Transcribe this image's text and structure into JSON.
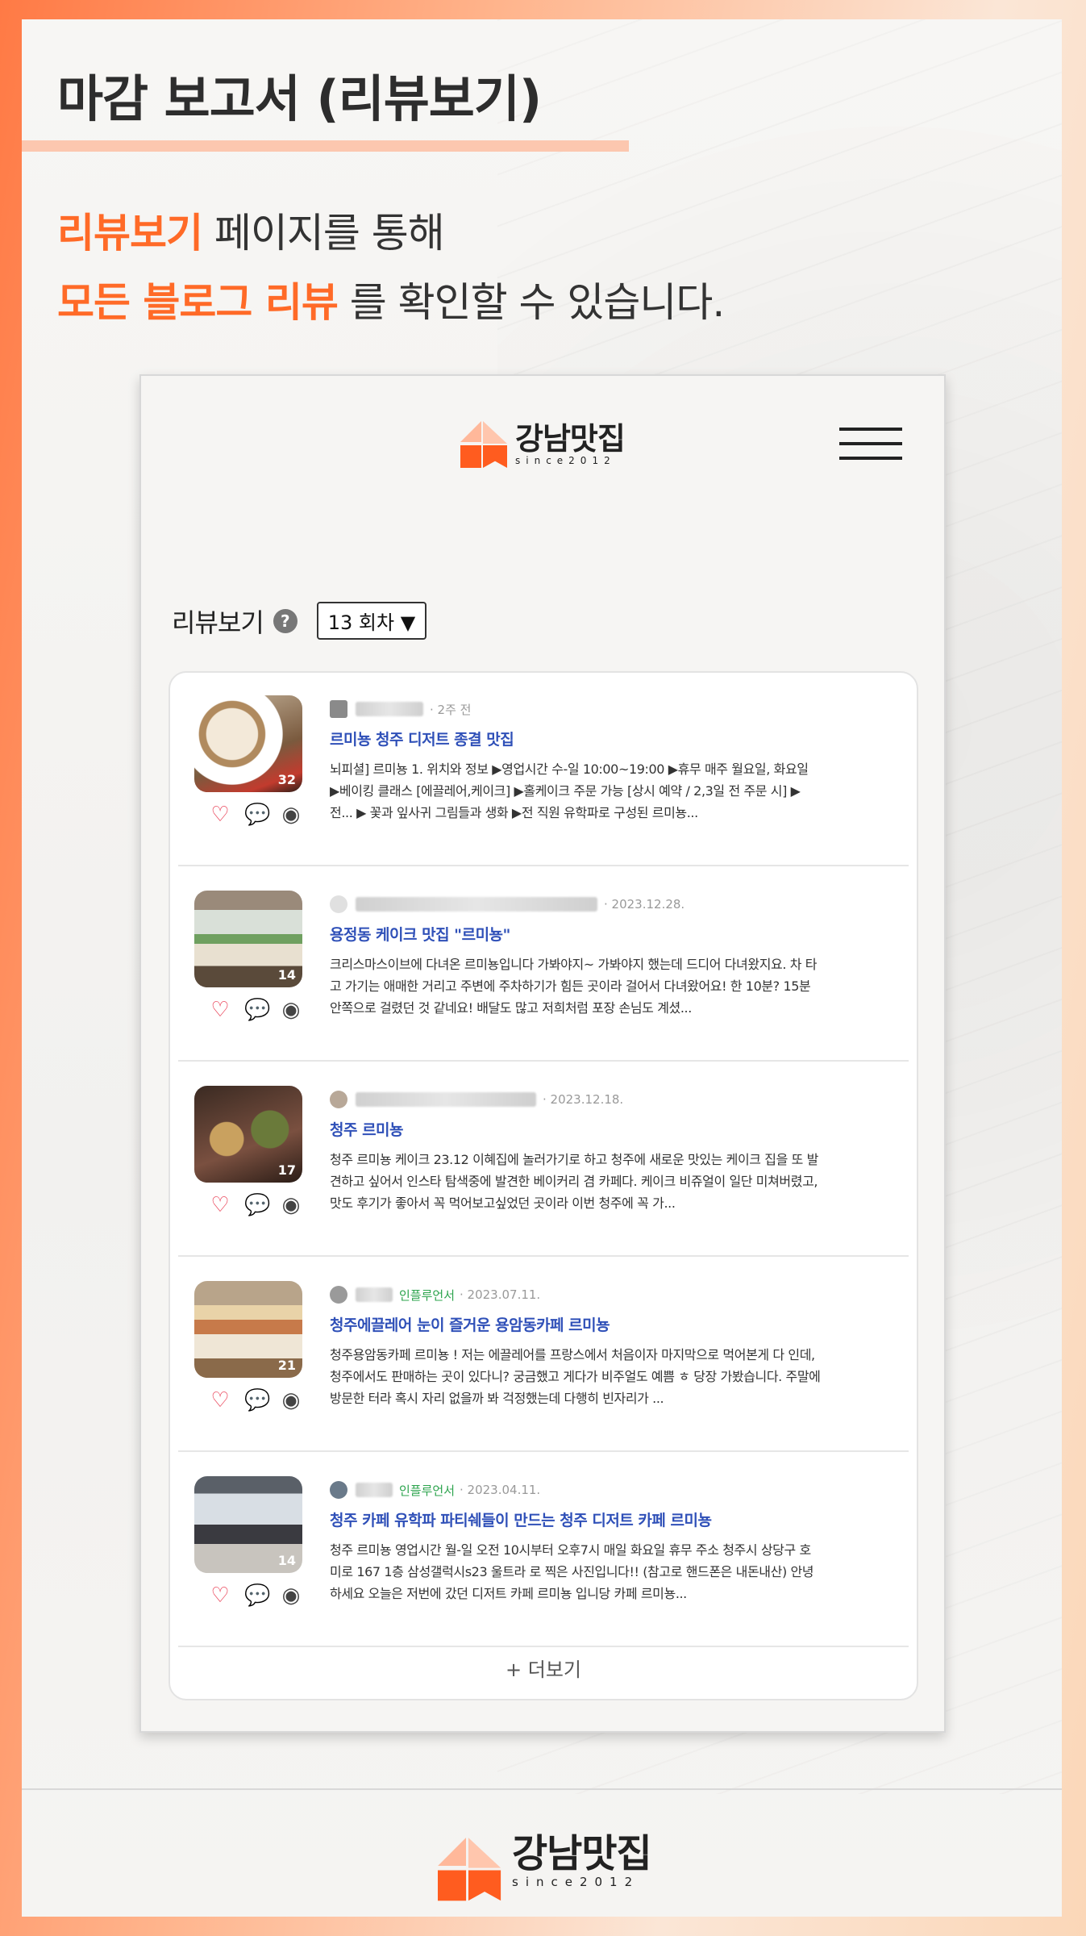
{
  "header": {
    "title": "마감 보고서 (리뷰보기)"
  },
  "intro": {
    "line1_hl": "리뷰보기",
    "line1_rest": " 페이지를 통해",
    "line2_hl": "모든 블로그 리뷰",
    "line2_rest": " 를 확인할 수 있습니다."
  },
  "app": {
    "logo_name": "강남맛집",
    "logo_since": "since2012"
  },
  "review": {
    "title": "리뷰보기",
    "help": "?",
    "round_select": "13 회차 ▼"
  },
  "items": [
    {
      "count": "32",
      "date": "· 2주 전",
      "influencer": "",
      "title": "르미뇽 청주 디저트 종결 맛집",
      "desc": "뇌피셜] 르미뇽 1. 위치와 정보 ▶영업시간 수-일 10:00~19:00 ▶휴무 매주 월요일, 화요일 ▶베이킹 클래스 [에끌레어,케이크] ▶홀케이크 주문 가능 [상시 예약 / 2,3일 전 주문 시] ▶전... ▶ 꽃과 잎사귀 그림들과 생화 ▶전 직원 유학파로 구성된 르미뇽..."
    },
    {
      "count": "14",
      "date": "· 2023.12.28.",
      "influencer": "",
      "title": "용정동 케이크 맛집 \"르미뇽\"",
      "desc": "크리스마스이브에 다녀온 르미뇽입니다 가봐야지~ 가봐야지 했는데 드디어 다녀왔지요. 차 타고 가기는 애매한 거리고 주변에 주차하기가 힘든 곳이라 걸어서 다녀왔어요! 한 10분? 15분 안쪽으로 걸렸던 것 같네요! 배달도 많고 저희처럼 포장 손님도 계셨..."
    },
    {
      "count": "17",
      "date": "· 2023.12.18.",
      "influencer": "",
      "title": "청주 르미뇽",
      "desc": "청주 르미뇽 케이크 23.12 이혜집에 놀러가기로 하고 청주에 새로운 맛있는 케이크 집을 또 발견하고 싶어서 인스타 탐색중에 발견한 베이커리 겸 카페다. 케이크 비쥬얼이 일단 미쳐버렸고, 맛도 후기가 좋아서 꼭 먹어보고싶었던 곳이라 이번 청주에 꼭 가..."
    },
    {
      "count": "21",
      "date": "· 2023.07.11.",
      "influencer": "인플루언서",
      "title": "청주에끌레어 눈이 즐거운 용암동카페 르미뇽",
      "desc": "청주용암동카페 르미뇽 ! 저는 에끌레어를 프랑스에서 처음이자 마지막으로 먹어본게 다 인데, 청주에서도 판매하는 곳이 있다니? 궁금했고 게다가 비주얼도 예쁨 ㅎ 당장 가봤습니다. 주말에 방문한 터라 혹시 자리 없을까 봐 걱정했는데 다행히 빈자리가 ..."
    },
    {
      "count": "14",
      "date": "· 2023.04.11.",
      "influencer": "인플루언서",
      "title": "청주 카페 유학파 파티쉐들이 만드는 청주 디저트 카페 르미뇽",
      "desc": "청주 르미뇽 영업시간 월-일 오전 10시부터 오후7시 매일 화요일 휴무 주소 청주시 상당구 호미로 167 1층 삼성갤럭시s23 울트라 로 찍은 사진입니다!! (참고로 핸드폰은 내돈내산) 안녕하세요 오늘은 저번에 갔던 디저트 카페 르미뇽 입니당 카페 르미뇽..."
    }
  ],
  "more_label": "+ 더보기",
  "colors": {
    "accent": "#ff6a27",
    "link": "#2f50b8",
    "heart": "#e8334a"
  }
}
